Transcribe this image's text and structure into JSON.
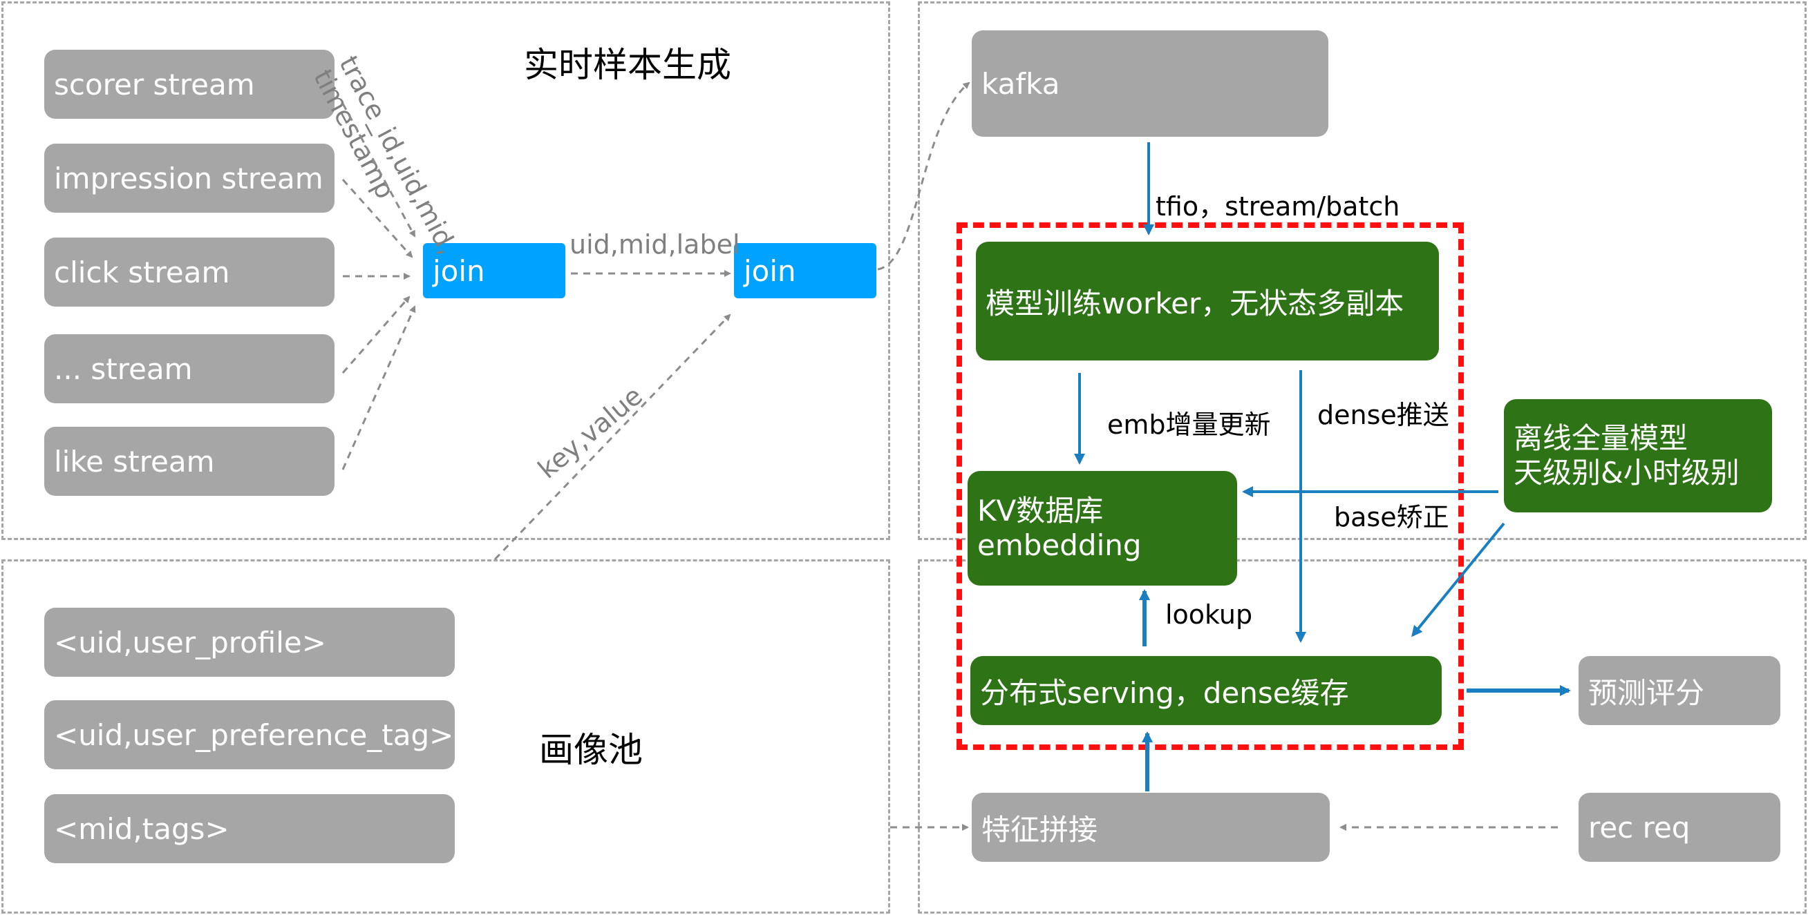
{
  "sections": {
    "realtime_sample_title": "实时样本生成",
    "profile_pool_title": "画像池"
  },
  "streams": [
    "scorer stream",
    "impression stream",
    "click stream",
    "... stream",
    "like stream"
  ],
  "joins": {
    "first": "join",
    "second": "join"
  },
  "edge_labels": {
    "trace_fields_line1": "trace_id,uid,mid,",
    "trace_fields_line2": "timestamp",
    "uid_mid_label": "uid,mid,label",
    "key_value": "key,value",
    "tfio": "tfio，stream/batch",
    "emb_update": "emb增量更新",
    "dense_push": "dense推送",
    "base_correction": "base矫正",
    "lookup": "lookup"
  },
  "profiles": [
    "<uid,user_profile>",
    "<uid,user_preference_tag>",
    "<mid,tags>"
  ],
  "nodes": {
    "kafka": "kafka",
    "trainer": "模型训练worker，无状态多副本",
    "kv_line1": "KV数据库",
    "kv_line2": "embedding",
    "offline_line1": "离线全量模型",
    "offline_line2": "天级别&小时级别",
    "serving": "分布式serving，dense缓存",
    "predict": "预测评分",
    "feature_join": "特征拼接",
    "rec_req": "rec req"
  },
  "colors": {
    "grey_box": "#a6a6a6",
    "blue_join": "#00a2ff",
    "green_node": "#2e7316",
    "red_frame": "#ff1010",
    "arrow_blue": "#1a7fc1",
    "dashed_border": "#a6a6a6"
  }
}
